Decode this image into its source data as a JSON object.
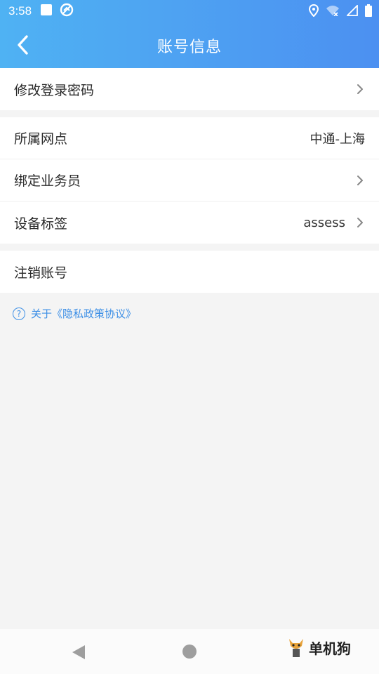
{
  "status_bar": {
    "time": "3:58"
  },
  "header": {
    "title": "账号信息"
  },
  "groups": [
    {
      "items": [
        {
          "label": "修改登录密码",
          "value": "",
          "chevron": true
        }
      ]
    },
    {
      "items": [
        {
          "label": "所属网点",
          "value": "中通-上海",
          "chevron": false
        },
        {
          "label": "绑定业务员",
          "value": "",
          "chevron": true
        },
        {
          "label": "设备标签",
          "value": "assess",
          "chevron": true
        }
      ]
    },
    {
      "items": [
        {
          "label": "注销账号",
          "value": "",
          "chevron": false
        }
      ]
    }
  ],
  "privacy_link": {
    "text": "关于《隐私政策协议》"
  },
  "watermark": {
    "text": "单机狗"
  },
  "colors": {
    "header_start": "#4fb2f3",
    "header_end": "#4c90f1",
    "link": "#3d8fe6",
    "background": "#f4f4f4"
  }
}
